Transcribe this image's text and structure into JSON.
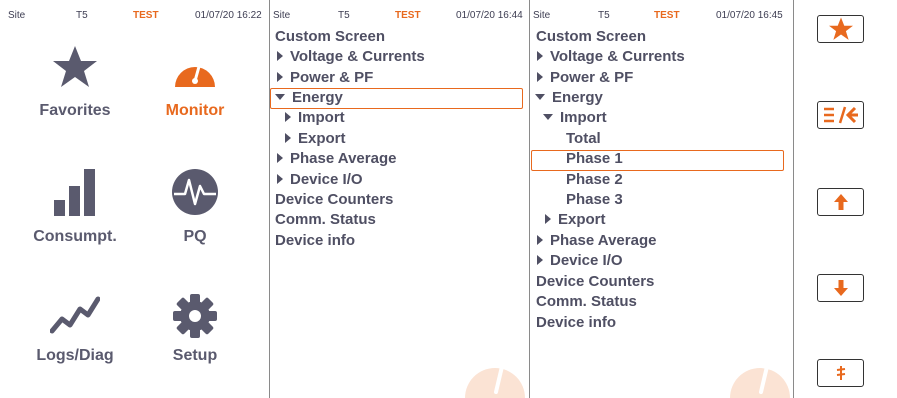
{
  "colors": {
    "accent": "#e8691e",
    "text": "#4f4f63",
    "icon": "#5a5a6e"
  },
  "screens": [
    {
      "status": {
        "site": "Site",
        "device": "T5",
        "mode": "TEST",
        "datetime": "01/07/20 16:22"
      }
    },
    {
      "status": {
        "site": "Site",
        "device": "T5",
        "mode": "TEST",
        "datetime": "01/07/20 16:44"
      }
    },
    {
      "status": {
        "site": "Site",
        "device": "T5",
        "mode": "TEST",
        "datetime": "01/07/20 16:45"
      }
    }
  ],
  "home_tiles": [
    {
      "label": "Favorites",
      "icon": "star-icon",
      "active": false
    },
    {
      "label": "Monitor",
      "icon": "gauge-icon",
      "active": true
    },
    {
      "label": "Consumpt.",
      "icon": "bar-chart-icon",
      "active": false
    },
    {
      "label": "PQ",
      "icon": "waveform-icon",
      "active": false
    },
    {
      "label": "Logs/Diag",
      "icon": "trend-line-icon",
      "active": false
    },
    {
      "label": "Setup",
      "icon": "gear-icon",
      "active": false
    }
  ],
  "menu2": [
    {
      "label": "Custom Screen"
    },
    {
      "label": "Voltage & Currents",
      "arrow": "right"
    },
    {
      "label": "Power & PF",
      "arrow": "right"
    },
    {
      "label": "Energy",
      "arrow": "down",
      "selected": true
    },
    {
      "label": "Import",
      "arrow": "right"
    },
    {
      "label": "Export",
      "arrow": "right"
    },
    {
      "label": "Phase Average",
      "arrow": "right"
    },
    {
      "label": "Device I/O",
      "arrow": "right"
    },
    {
      "label": "Device Counters"
    },
    {
      "label": "Comm. Status"
    },
    {
      "label": "Device info"
    }
  ],
  "menu3": [
    {
      "label": "Custom Screen"
    },
    {
      "label": "Voltage & Currents",
      "arrow": "right"
    },
    {
      "label": "Power & PF",
      "arrow": "right"
    },
    {
      "label": "Energy",
      "arrow": "down"
    },
    {
      "label": "Import",
      "arrow": "down"
    },
    {
      "label": "Total"
    },
    {
      "label": "Phase 1",
      "selected": true
    },
    {
      "label": "Phase 2"
    },
    {
      "label": "Phase 3"
    },
    {
      "label": "Export",
      "arrow": "right"
    },
    {
      "label": "Phase Average",
      "arrow": "right"
    },
    {
      "label": "Device I/O",
      "arrow": "right"
    },
    {
      "label": "Device Counters"
    },
    {
      "label": "Comm. Status"
    },
    {
      "label": "Device info"
    }
  ],
  "keys": [
    {
      "name": "favorites-key",
      "icon": "star-icon"
    },
    {
      "name": "back-key",
      "icon": "menu-back-icon"
    },
    {
      "name": "up-key",
      "icon": "arrow-up-icon"
    },
    {
      "name": "down-key",
      "icon": "arrow-down-icon"
    },
    {
      "name": "extra-key",
      "icon": "symbol-icon"
    }
  ]
}
